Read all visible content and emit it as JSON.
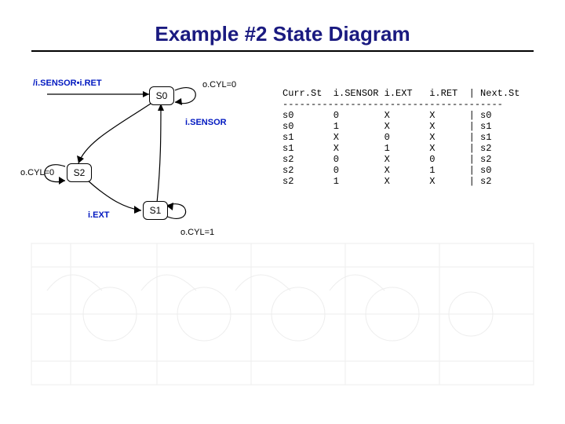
{
  "title": "Example #2 State Diagram",
  "states": {
    "s0": "S0",
    "s1": "S1",
    "s2": "S2"
  },
  "transition_labels": {
    "s0_self": "o.CYL=0",
    "s0_initial": "/i.SENSOR•i.RET",
    "s0_to_s2": "i.SENSOR",
    "s2_self": "o.CYL=0",
    "s2_to_s1": "i.EXT",
    "s1_self": "o.CYL=1"
  },
  "table": {
    "header": "Curr.St  i.SENSOR i.EXT   i.RET  | Next.St",
    "divider": "---------------------------------------",
    "rows": [
      {
        "curr": "s0",
        "sensor": "0",
        "ext": "X",
        "ret": "X",
        "next": "s0"
      },
      {
        "curr": "s0",
        "sensor": "1",
        "ext": "X",
        "ret": "X",
        "next": "s1"
      },
      {
        "curr": "s1",
        "sensor": "X",
        "ext": "0",
        "ret": "X",
        "next": "s1"
      },
      {
        "curr": "s1",
        "sensor": "X",
        "ext": "1",
        "ret": "X",
        "next": "s2"
      },
      {
        "curr": "s2",
        "sensor": "0",
        "ext": "X",
        "ret": "0",
        "next": "s2"
      },
      {
        "curr": "s2",
        "sensor": "0",
        "ext": "X",
        "ret": "1",
        "next": "s0"
      },
      {
        "curr": "s2",
        "sensor": "1",
        "ext": "X",
        "ret": "X",
        "next": "s2"
      }
    ]
  },
  "chart_data": {
    "type": "table",
    "title": "State transition table (Moore machine)",
    "states": [
      "S0",
      "S1",
      "S2"
    ],
    "inputs": [
      "i.SENSOR",
      "i.EXT",
      "i.RET"
    ],
    "output": "o.CYL",
    "state_outputs": {
      "S0": 0,
      "S1": 1,
      "S2": 0
    },
    "transitions": [
      {
        "from": "S0",
        "to": "S0",
        "cond": "i.SENSOR=0"
      },
      {
        "from": "S0",
        "to": "S1",
        "cond": "i.SENSOR=1"
      },
      {
        "from": "S1",
        "to": "S1",
        "cond": "i.EXT=0"
      },
      {
        "from": "S1",
        "to": "S2",
        "cond": "i.EXT=1"
      },
      {
        "from": "S2",
        "to": "S2",
        "cond": "i.RET=0 & i.SENSOR=0"
      },
      {
        "from": "S2",
        "to": "S0",
        "cond": "i.RET=1"
      },
      {
        "from": "S2",
        "to": "S2",
        "cond": "i.SENSOR=1"
      }
    ]
  }
}
